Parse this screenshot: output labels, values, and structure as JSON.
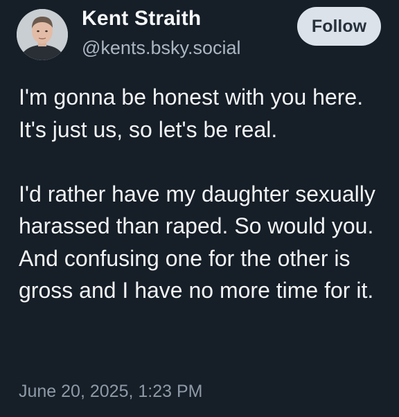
{
  "author": {
    "display_name": "Kent Straith",
    "handle": "@kents.bsky.social",
    "avatar_icon": "user-photo-avatar"
  },
  "follow_label": "Follow",
  "post": {
    "paragraph_1": "I'm gonna be honest with you here. It's just us, so let's be real.",
    "paragraph_2": "I'd rather have my daughter sexually harassed than raped. So would you. And confusing one for the other is gross and I have no more time for it."
  },
  "timestamp": "June 20, 2025, 1:23 PM",
  "colors": {
    "background": "#161e27",
    "text": "#f1f3f5",
    "handle": "#aab6c3",
    "timestamp": "#8d9aa8",
    "follow_bg": "#dce2ea",
    "follow_text": "#27313c"
  }
}
